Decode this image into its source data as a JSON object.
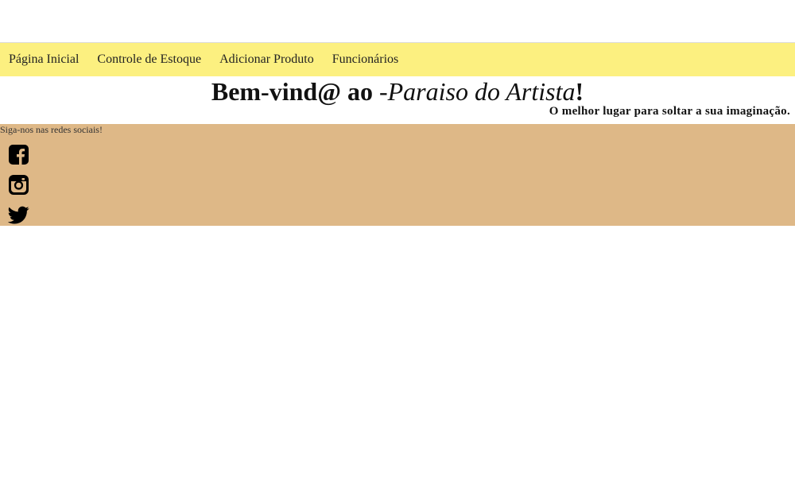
{
  "navbar": {
    "links": [
      {
        "label": "Página Inicial"
      },
      {
        "label": "Controle de Estoque"
      },
      {
        "label": "Adicionar Produto"
      },
      {
        "label": "Funcionários"
      }
    ]
  },
  "header": {
    "title_prefix": "Bem-vind@ ao ",
    "title_dash": "-",
    "title_brand": "Paraiso do Artista",
    "title_suffix": "!",
    "subtitle": "O melhor lugar para soltar a sua imaginação."
  },
  "social": {
    "caption": "Siga-nos nas redes sociais!",
    "icons": [
      "facebook-icon",
      "instagram-icon",
      "twitter-icon"
    ]
  },
  "colors": {
    "navbar_bg": "#fcf080",
    "social_bg": "#deb887"
  }
}
